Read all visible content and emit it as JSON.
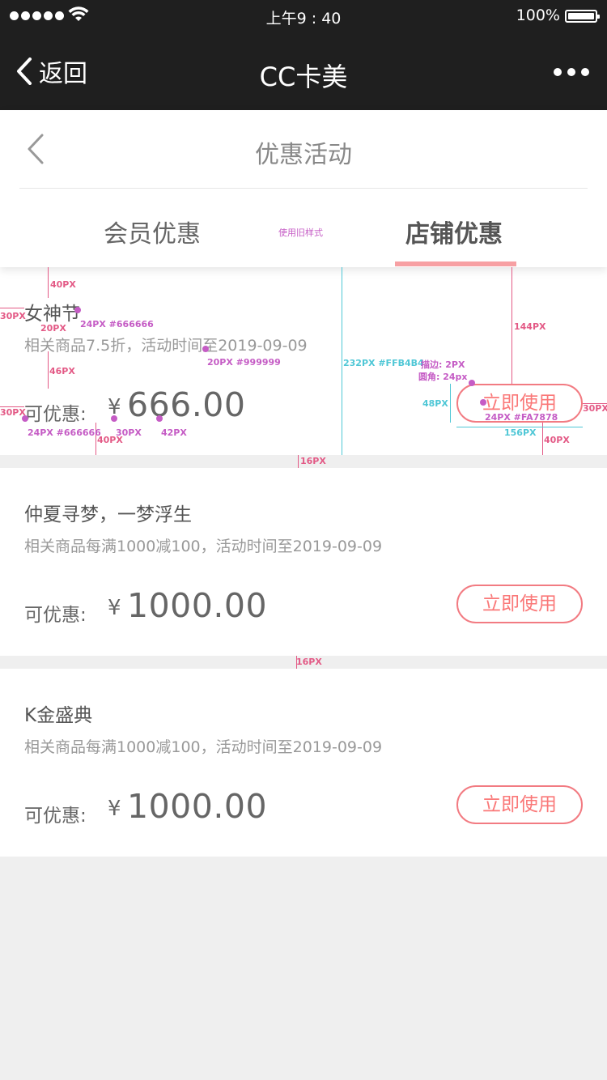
{
  "status_bar": {
    "time": "上午9 : 40",
    "battery": "100%"
  },
  "nav": {
    "back_label": "返回",
    "title": "CC卡美"
  },
  "header": {
    "title": "优惠活动",
    "tabs": [
      {
        "label": "会员优惠",
        "active": false
      },
      {
        "label": "店铺优惠",
        "active": true
      }
    ],
    "tab_note": "使用旧样式"
  },
  "coupons": [
    {
      "title": "女神节",
      "desc": "相关商品7.5折，活动时间至2019-09-09",
      "label": "可优惠:",
      "currency": "¥",
      "amount": "666.00",
      "button": "立即使用"
    },
    {
      "title": "仲夏寻梦，一梦浮生",
      "desc": "相关商品每满1000减100，活动时间至2019-09-09",
      "label": "可优惠:",
      "currency": "¥",
      "amount": "1000.00",
      "button": "立即使用"
    },
    {
      "title": "K金盛典",
      "desc": "相关商品每满1000减100，活动时间至2019-09-09",
      "label": "可优惠:",
      "currency": "¥",
      "amount": "1000.00",
      "button": "立即使用"
    }
  ],
  "annotations": {
    "top_40": "40PX",
    "left_30": "30PX",
    "gap_20": "20PX",
    "title_spec": "24PX #666666",
    "gap_46": "46PX",
    "desc_spec": "20PX #999999",
    "card_height": "232PX #FFB4B4",
    "stroke": "描边: 2PX",
    "radius": "圆角: 24px",
    "btn_top": "144PX",
    "btn_height": "48PX",
    "btn_text": "24PX #FA7878",
    "btn_width": "156PX",
    "btn_bottom": "40PX",
    "right_30": "30PX",
    "label_spec": "24PX #666666",
    "bottom_40": "40PX",
    "yen_gap": "30PX",
    "price_size": "42PX",
    "gap_16a": "16PX",
    "gap_16b": "16PX"
  },
  "colors": {
    "nav_bg": "#1f1f1f",
    "accent": "#fa7878",
    "button_border": "#f27b82",
    "tab_underline": "#f7a0a3",
    "page_bg": "#efefef"
  }
}
